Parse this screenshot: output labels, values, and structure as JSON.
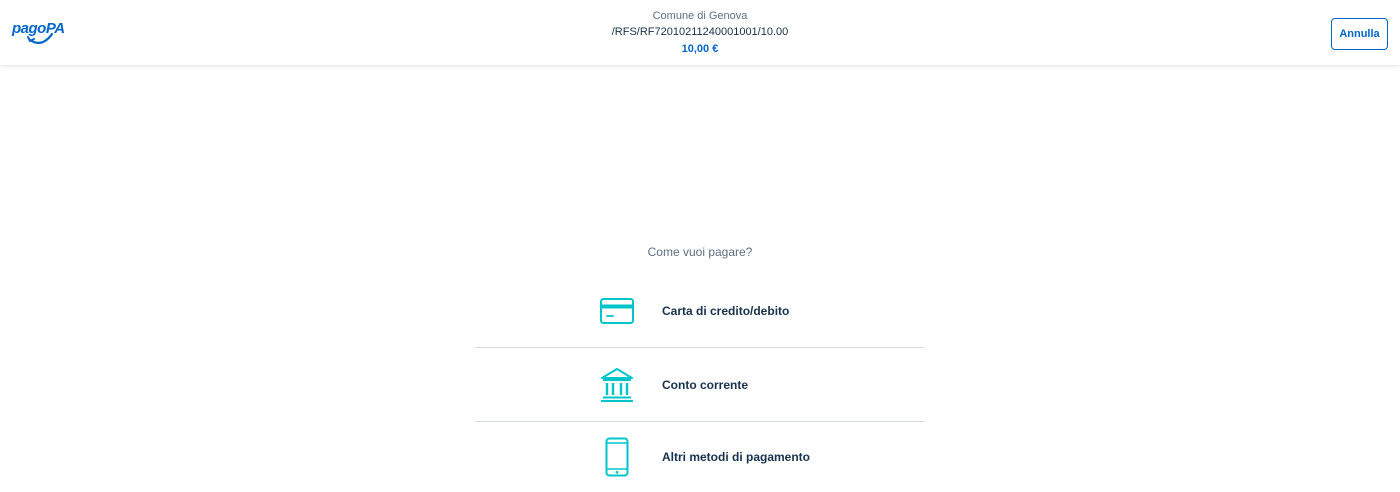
{
  "header": {
    "logo_text": "pagoPA",
    "entity": "Comune di Genova",
    "code": "/RFS/RF72010211240001001/10.00",
    "amount": "10,00 €",
    "cancel_label": "Annulla"
  },
  "main": {
    "question": "Come vuoi pagare?",
    "methods": [
      {
        "label": "Carta di credito/debito",
        "icon": "credit-card-icon"
      },
      {
        "label": "Conto corrente",
        "icon": "bank-icon"
      },
      {
        "label": "Altri metodi di pagamento",
        "icon": "smartphone-icon"
      }
    ]
  },
  "colors": {
    "brand": "#0066cc",
    "icon": "#00c5ca",
    "text": "#17324d",
    "muted": "#5c6f82"
  }
}
